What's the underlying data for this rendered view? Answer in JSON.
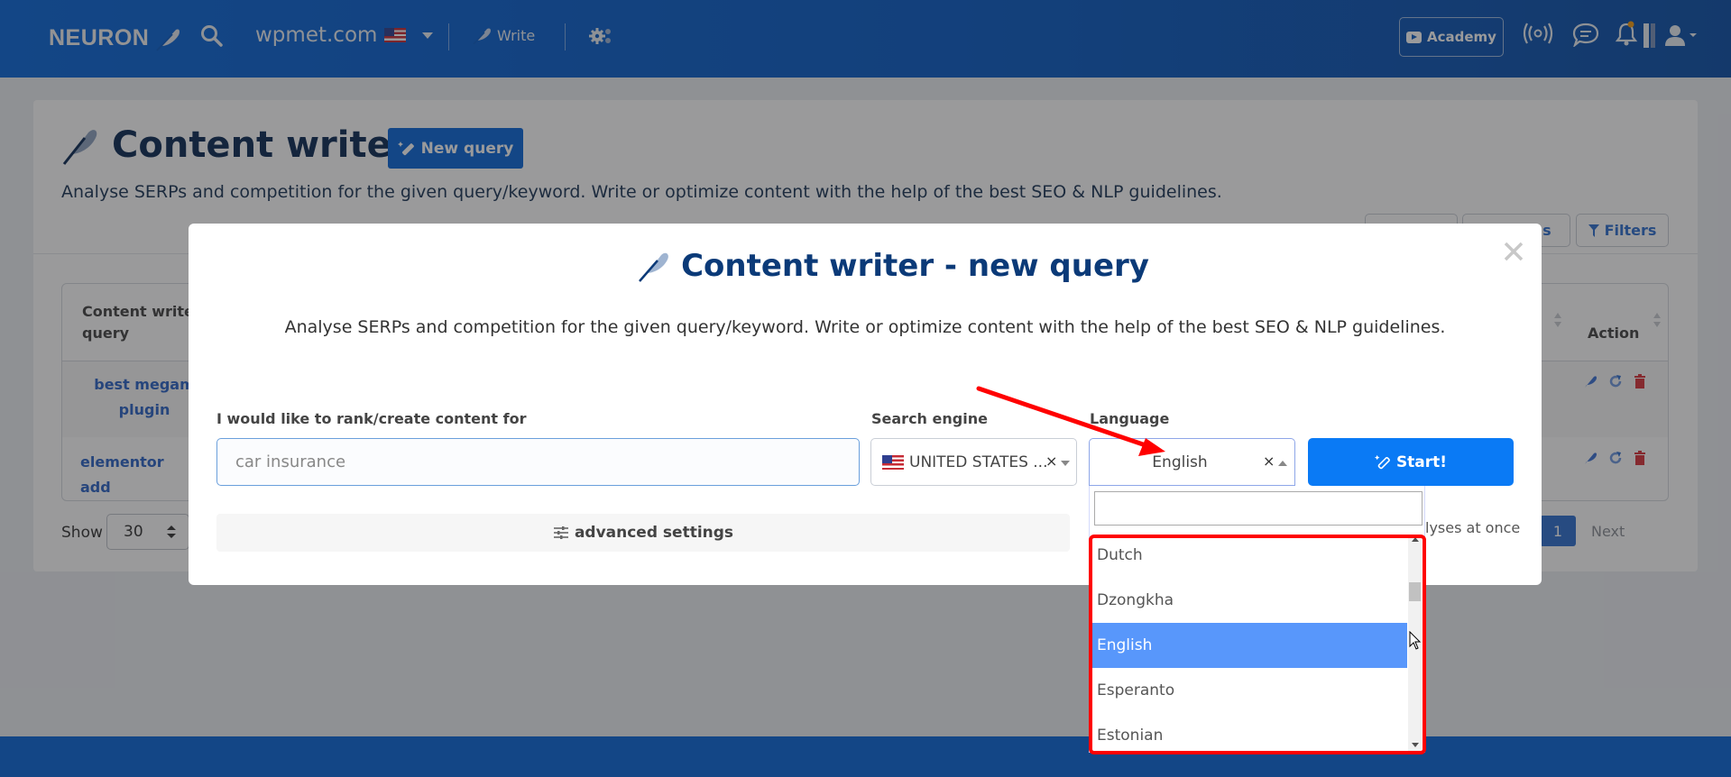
{
  "navbar": {
    "logo_text": "NEURON",
    "domain": "wpmet.com",
    "write_label": "Write",
    "academy_label": "Academy",
    "icons": [
      "search-icon",
      "flag-us-icon",
      "chevron-down-icon",
      "feather-icon",
      "gear-icon",
      "broadcast-icon",
      "chat-icon",
      "bell-icon",
      "user-icon"
    ]
  },
  "page": {
    "title": "Content writer",
    "new_query_label": "New query",
    "description": "Analyse SERPs and competition for the given query/keyword. Write or optimize content with the help of the best SEO & NLP guidelines.",
    "toolbar_buttons": [
      {
        "label": ""
      },
      {
        "label": "Columns"
      },
      {
        "label": "Filters"
      }
    ],
    "table": {
      "headers": [
        {
          "line1": "Content writer",
          "line2": "query"
        },
        {
          "line1": "Action",
          "line2": ""
        }
      ],
      "rows": [
        {
          "query_line1": "best megam",
          "query_line2": "plugin"
        },
        {
          "query_line1": "elementor add",
          "query_line2": ""
        }
      ]
    },
    "show_label": "Show",
    "show_value": "30",
    "current_page": "1",
    "next_label": "Next"
  },
  "modal": {
    "title": "Content writer - new query",
    "description": "Analyse SERPs and competition for the given query/keyword. Write or optimize content with the help of the best SEO & NLP guidelines.",
    "query_label": "I would like to rank/create content for",
    "query_placeholder": "car insurance",
    "query_value": "",
    "search_engine_label": "Search engine",
    "search_engine_value": "UNITED STATES ...",
    "language_label": "Language",
    "language_value": "English",
    "start_label": "Start!",
    "advanced_label": "advanced settings",
    "analyses_text": "lyses at once",
    "clear_symbol": "×",
    "close_symbol": "×"
  },
  "language_dropdown": {
    "search_value": "",
    "options": [
      {
        "label": "Dutch",
        "selected": false
      },
      {
        "label": "Dzongkha",
        "selected": false
      },
      {
        "label": "English",
        "selected": true
      },
      {
        "label": "Esperanto",
        "selected": false
      },
      {
        "label": "Estonian",
        "selected": false
      }
    ]
  },
  "annotation": {
    "color": "#ff0000",
    "note": "red arrow pointing to Language select; red box around options list"
  },
  "colors": {
    "brand": "#0a66d9",
    "start_button": "#0a7af5",
    "selected_option": "#5897fb"
  }
}
